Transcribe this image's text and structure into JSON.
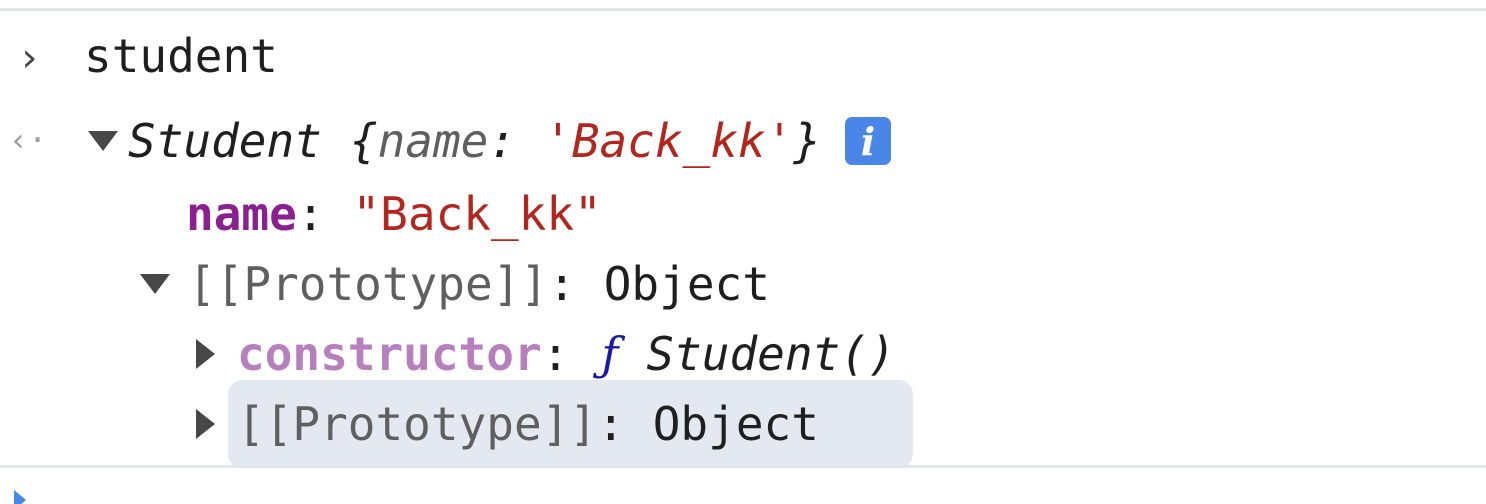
{
  "input_line": {
    "prompt_glyph": "›",
    "expression": "student"
  },
  "result_line": {
    "return_glyph": "‹·",
    "class_name": "Student",
    "open_brace": "{",
    "preview_key": "name",
    "colon": ":",
    "preview_value": "'Back_kk'",
    "close_brace": "}",
    "info_glyph": "i"
  },
  "tree": {
    "name_key": "name",
    "name_colon": ":",
    "name_value": "\"Back_kk\"",
    "proto_label": "[[Prototype]]",
    "proto_colon": ":",
    "proto_value": "Object",
    "constructor_key": "constructor",
    "constructor_colon": ":",
    "constructor_fn_mark": "ƒ",
    "constructor_value": "Student()",
    "inner_proto_label": "[[Prototype]]",
    "inner_proto_colon": ":",
    "inner_proto_value": "Object"
  },
  "colors": {
    "string": "#b3261e",
    "own_key": "#8a1f8f",
    "proto_key": "#b87fbf",
    "selection": "#e3e8f1",
    "info_badge": "#4a86e8"
  }
}
